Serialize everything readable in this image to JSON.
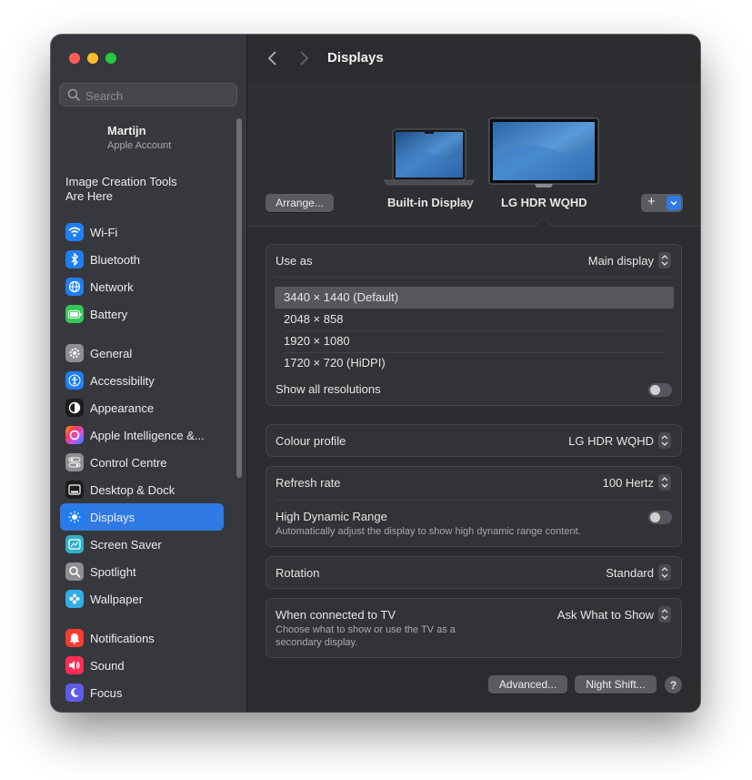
{
  "window": {
    "title": "Displays"
  },
  "sidebar": {
    "search_placeholder": "Search",
    "account": {
      "name": "Martijn",
      "subtitle": "Apple Account"
    },
    "promo": {
      "line1": "Image Creation Tools",
      "line2": "Are Here"
    },
    "items": [
      {
        "label": "Wi-Fi",
        "icon": "wifi-icon",
        "color": "#1f7ff0"
      },
      {
        "label": "Bluetooth",
        "icon": "bluetooth-icon",
        "color": "#1f7ff0"
      },
      {
        "label": "Network",
        "icon": "globe-icon",
        "color": "#1f7ff0"
      },
      {
        "label": "Battery",
        "icon": "battery-icon",
        "color": "#34c759"
      },
      {
        "label": "General",
        "icon": "gear-icon",
        "color": "#8e8e93"
      },
      {
        "label": "Accessibility",
        "icon": "accessibility-icon",
        "color": "#1f7ff0"
      },
      {
        "label": "Appearance",
        "icon": "appearance-icon",
        "color": "#1c1c1e"
      },
      {
        "label": "Apple Intelligence &...",
        "icon": "apple-intelligence-icon",
        "color": "#c060e0"
      },
      {
        "label": "Control Centre",
        "icon": "control-centre-icon",
        "color": "#8e8e93"
      },
      {
        "label": "Desktop & Dock",
        "icon": "dock-icon",
        "color": "#1c1c1e"
      },
      {
        "label": "Displays",
        "icon": "sun-icon",
        "color": "#1f7ff0",
        "active": true
      },
      {
        "label": "Screen Saver",
        "icon": "screen-saver-icon",
        "color": "#30b0c7"
      },
      {
        "label": "Spotlight",
        "icon": "magnifier-icon",
        "color": "#8e8e93"
      },
      {
        "label": "Wallpaper",
        "icon": "flower-icon",
        "color": "#32ade6"
      },
      {
        "label": "Notifications",
        "icon": "bell-icon",
        "color": "#ff3b30"
      },
      {
        "label": "Sound",
        "icon": "speaker-icon",
        "color": "#ff2d55"
      },
      {
        "label": "Focus",
        "icon": "moon-icon",
        "color": "#5e5ce6"
      }
    ]
  },
  "displays": {
    "arrange_label": "Arrange...",
    "builtin_label": "Built-in Display",
    "external_label": "LG HDR WQHD",
    "add_label": "+"
  },
  "settings": {
    "use_as": {
      "label": "Use as",
      "value": "Main display"
    },
    "resolutions": [
      {
        "label": "3440 × 1440 (Default)",
        "selected": true
      },
      {
        "label": "2048 × 858"
      },
      {
        "label": "1920 × 1080"
      },
      {
        "label": "1720 × 720 (HiDPI)"
      }
    ],
    "show_all": {
      "label": "Show all resolutions",
      "on": false
    },
    "colour_profile": {
      "label": "Colour profile",
      "value": "LG HDR WQHD"
    },
    "refresh_rate": {
      "label": "Refresh rate",
      "value": "100 Hertz"
    },
    "hdr": {
      "label": "High Dynamic Range",
      "sub": "Automatically adjust the display to show high dynamic range content.",
      "on": false
    },
    "rotation": {
      "label": "Rotation",
      "value": "Standard"
    },
    "tv": {
      "label": "When connected to TV",
      "sub1": "Choose what to show or use the TV as a",
      "sub2": "secondary display.",
      "value": "Ask What to Show"
    }
  },
  "footer": {
    "advanced_label": "Advanced...",
    "night_shift_label": "Night Shift...",
    "help_label": "?"
  }
}
